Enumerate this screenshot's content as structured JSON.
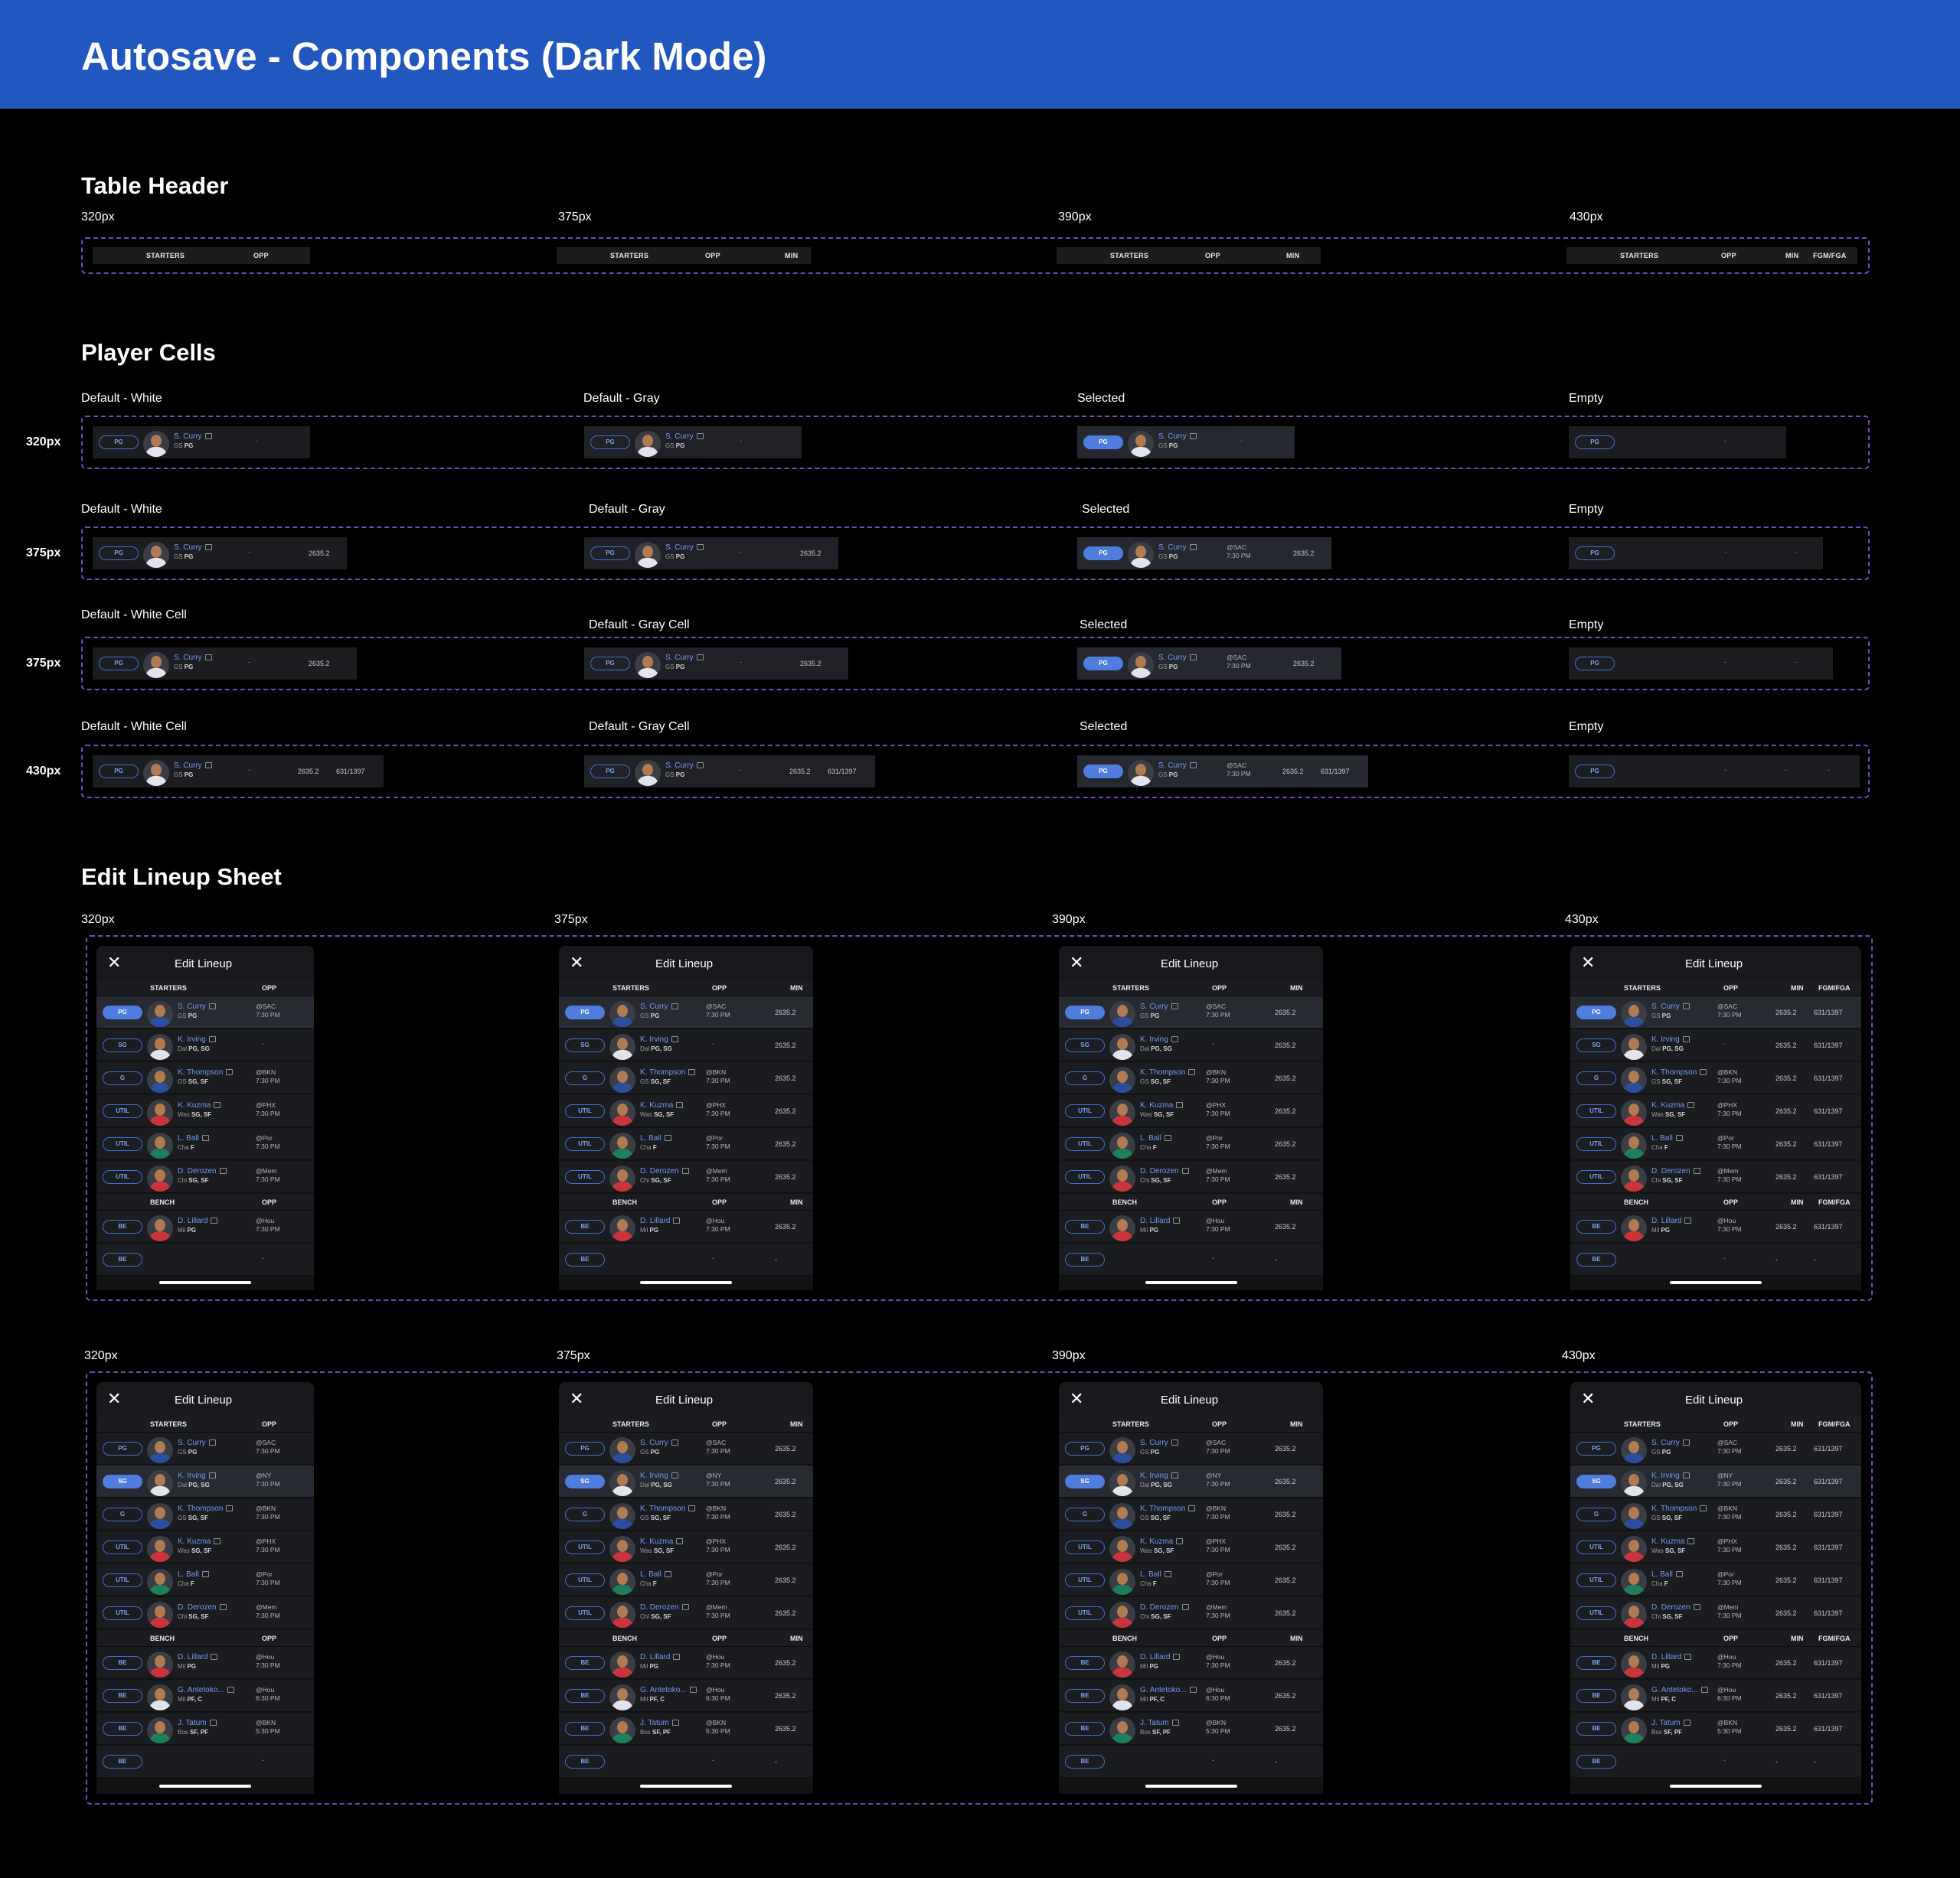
{
  "page_title": "Autosave - Components (Dark Mode)",
  "sections": {
    "table_header": "Table Header",
    "player_cells": "Player Cells",
    "edit_lineup_sheet": "Edit Lineup Sheet"
  },
  "widths": {
    "w320": "320px",
    "w375": "375px",
    "w390": "390px",
    "w430": "430px"
  },
  "variants": {
    "default_white": "Default - White",
    "default_gray": "Default - Gray",
    "default_white_cell": "Default - White Cell",
    "default_gray_cell": "Default - Gray Cell",
    "selected": "Selected",
    "empty": "Empty"
  },
  "columns": {
    "starters": "STARTERS",
    "bench": "BENCH",
    "opp": "OPP",
    "min": "MIN",
    "fgm": "FGM/FGA"
  },
  "sheet_title": "Edit Lineup",
  "close_glyph": "✕",
  "dash": "-",
  "sample": {
    "pos": "PG",
    "name": "S. Curry",
    "team": "GS",
    "tpos": "PG",
    "opp": "@SAC",
    "time": "7:30 PM",
    "min": "2635.2",
    "fgm": "631/1397"
  },
  "starters_a": [
    {
      "pos": "PG",
      "name": "S. Curry",
      "team": "GS",
      "tpos": "PG",
      "opp": "@SAC",
      "time": "7:30 PM",
      "min": "2635.2",
      "fgm": "631/1397"
    },
    {
      "pos": "SG",
      "name": "K. Irving",
      "team": "Dal",
      "tpos": "PG, SG",
      "opp": "-",
      "time": "",
      "min": "2635.2",
      "fgm": "631/1397"
    },
    {
      "pos": "G",
      "name": "K. Thompson",
      "team": "GS",
      "tpos": "SG, SF",
      "opp": "@BKN",
      "time": "7:30 PM",
      "min": "2635.2",
      "fgm": "631/1397"
    },
    {
      "pos": "UTIL",
      "name": "K. Kuzma",
      "team": "Was",
      "tpos": "SG, SF",
      "opp": "@PHX",
      "time": "7:30 PM",
      "min": "2635.2",
      "fgm": "631/1397"
    },
    {
      "pos": "UTIL",
      "name": "L. Ball",
      "team": "Cha",
      "tpos": "F",
      "opp": "@Por",
      "time": "7:30 PM",
      "min": "2635.2",
      "fgm": "631/1397"
    },
    {
      "pos": "UTIL",
      "name": "D. Derozen",
      "team": "Chi",
      "tpos": "SG, SF",
      "opp": "@Mem",
      "time": "7:30 PM",
      "min": "2635.2",
      "fgm": "631/1397"
    }
  ],
  "bench_a": [
    {
      "pos": "BE",
      "name": "D. Lillard",
      "team": "Mil",
      "tpos": "PG",
      "opp": "@Hou",
      "time": "7:30 PM",
      "min": "2635.2",
      "fgm": "631/1397"
    },
    {
      "pos": "BE",
      "name": "",
      "team": "",
      "tpos": "",
      "opp": "-",
      "time": "",
      "min": "-",
      "fgm": "-"
    }
  ],
  "starters_b": [
    {
      "pos": "PG",
      "name": "S. Curry",
      "team": "GS",
      "tpos": "PG",
      "opp": "@SAC",
      "time": "7:30 PM",
      "min": "2635.2",
      "fgm": "631/1397"
    },
    {
      "pos": "SG",
      "name": "K. Irving",
      "team": "Dal",
      "tpos": "PG, SG",
      "opp": "@NY",
      "time": "7:30 PM",
      "min": "2635.2",
      "fgm": "631/1397"
    },
    {
      "pos": "G",
      "name": "K. Thompson",
      "team": "GS",
      "tpos": "SG, SF",
      "opp": "@BKN",
      "time": "7:30 PM",
      "min": "2635.2",
      "fgm": "631/1397"
    },
    {
      "pos": "UTIL",
      "name": "K. Kuzma",
      "team": "Was",
      "tpos": "SG, SF",
      "opp": "@PHX",
      "time": "7:30 PM",
      "min": "2635.2",
      "fgm": "631/1397"
    },
    {
      "pos": "UTIL",
      "name": "L. Ball",
      "team": "Cha",
      "tpos": "F",
      "opp": "@Por",
      "time": "7:30 PM",
      "min": "2635.2",
      "fgm": "631/1397"
    },
    {
      "pos": "UTIL",
      "name": "D. Derozen",
      "team": "Chi",
      "tpos": "SG, SF",
      "opp": "@Mem",
      "time": "7:30 PM",
      "min": "2635.2",
      "fgm": "631/1397"
    }
  ],
  "bench_b": [
    {
      "pos": "BE",
      "name": "D. Lillard",
      "team": "Mil",
      "tpos": "PG",
      "opp": "@Hou",
      "time": "7:30 PM",
      "min": "2635.2",
      "fgm": "631/1397"
    },
    {
      "pos": "BE",
      "name": "G. Antetoko...",
      "team": "Mil",
      "tpos": "PF, C",
      "opp": "@Hou",
      "time": "6:30 PM",
      "min": "2635.2",
      "fgm": "631/1397"
    },
    {
      "pos": "BE",
      "name": "J. Tatum",
      "team": "Bos",
      "tpos": "SF, PF",
      "opp": "@BKN",
      "time": "5:30 PM",
      "min": "2635.2",
      "fgm": "631/1397"
    },
    {
      "pos": "BE",
      "name": "",
      "team": "",
      "tpos": "",
      "opp": "-",
      "time": "",
      "min": "-",
      "fgm": "-"
    }
  ],
  "colors": {
    "banner": "#2257bf",
    "accent": "#4f7ddd",
    "link": "#6f9bf0",
    "dashed": "#7446c8"
  }
}
